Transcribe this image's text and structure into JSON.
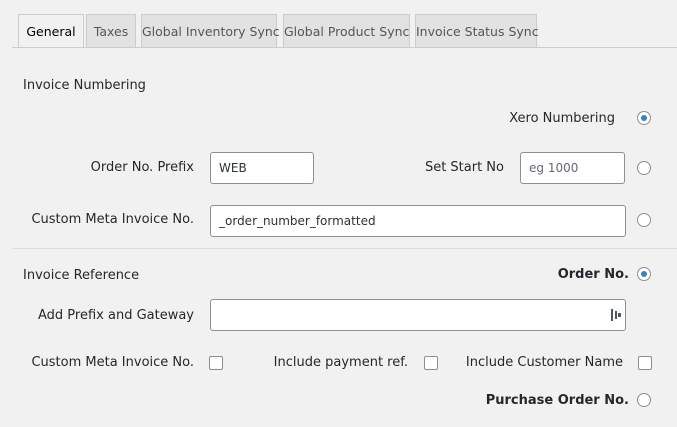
{
  "tabs": [
    "General",
    "Taxes",
    "Global Inventory Sync",
    "Global Product Sync",
    "Invoice Status Sync"
  ],
  "active_tab": "General",
  "invoice_numbering": {
    "heading": "Invoice Numbering",
    "xero_numbering_label": "Xero Numbering",
    "xero_numbering_selected": true,
    "order_prefix_label": "Order No. Prefix",
    "order_prefix_value": "WEB",
    "set_start_label": "Set Start No",
    "set_start_placeholder": "eg 1000",
    "set_start_selected": false,
    "custom_meta_label": "Custom Meta Invoice No.",
    "custom_meta_value": "_order_number_formatted",
    "custom_meta_selected": false
  },
  "invoice_reference": {
    "heading": "Invoice Reference",
    "order_no_label": "Order No.",
    "order_no_selected": true,
    "add_prefix_label": "Add Prefix and Gateway",
    "add_prefix_value": "",
    "custom_meta_label": "Custom Meta Invoice No.",
    "custom_meta_checked": false,
    "include_payment_label": "Include payment ref.",
    "include_payment_checked": false,
    "include_customer_label": "Include Customer Name",
    "include_customer_checked": false,
    "purchase_order_label": "Purchase Order No.",
    "purchase_order_selected": false
  },
  "colors": {
    "accent": "#3582c4",
    "background": "#f1f1f1"
  },
  "icons": {
    "password_manager": "password-manager-icon"
  }
}
